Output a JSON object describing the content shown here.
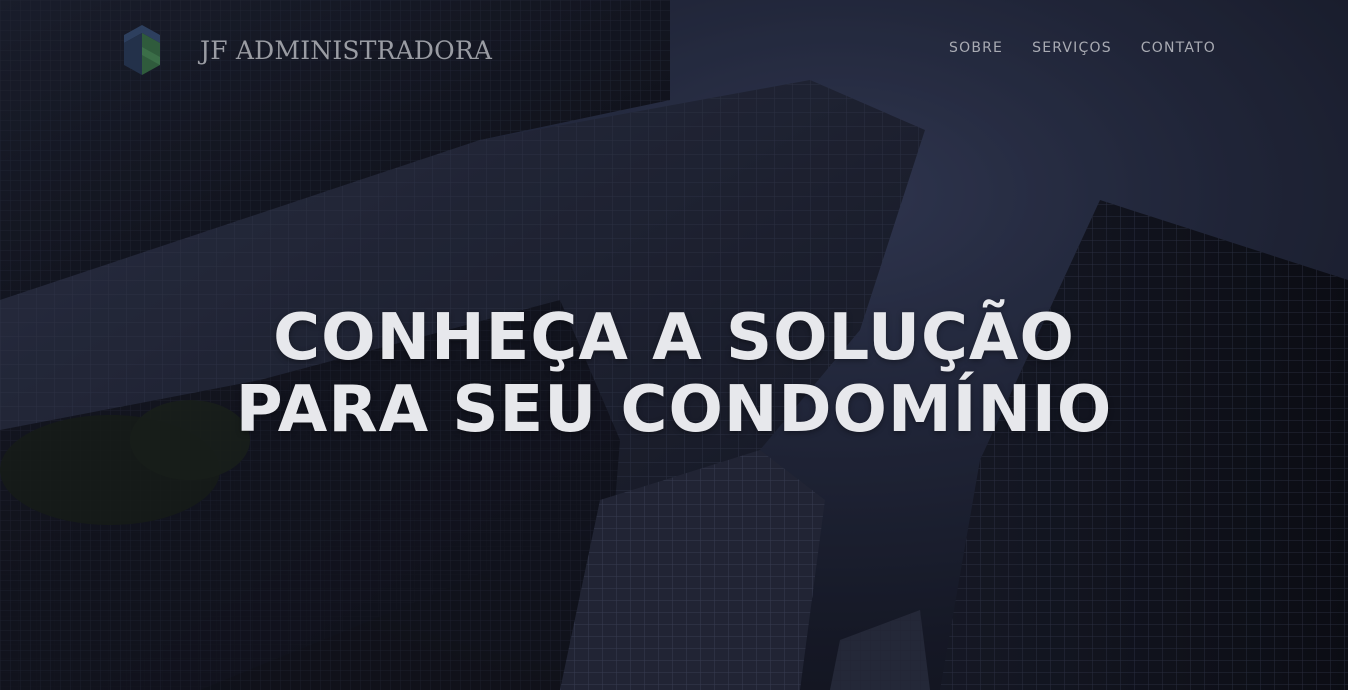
{
  "brand": {
    "name": "JF ADMINISTRADORA",
    "logo_icon": "building-logo-icon"
  },
  "nav": {
    "items": [
      {
        "label": "SOBRE"
      },
      {
        "label": "SERVIÇOS"
      },
      {
        "label": "CONTATO"
      }
    ]
  },
  "hero": {
    "headline_line1": "CONHEÇA A SOLUÇÃO",
    "headline_line2": "PARA SEU CONDOMÍNIO",
    "background": "skyscrapers-photo"
  },
  "colors": {
    "text": "#e7e8ec",
    "nav_text": "#a9abb3",
    "brand_text": "#9a9ca3",
    "logo_green": "#2f5b3c",
    "logo_blue": "#2d3f5e"
  }
}
